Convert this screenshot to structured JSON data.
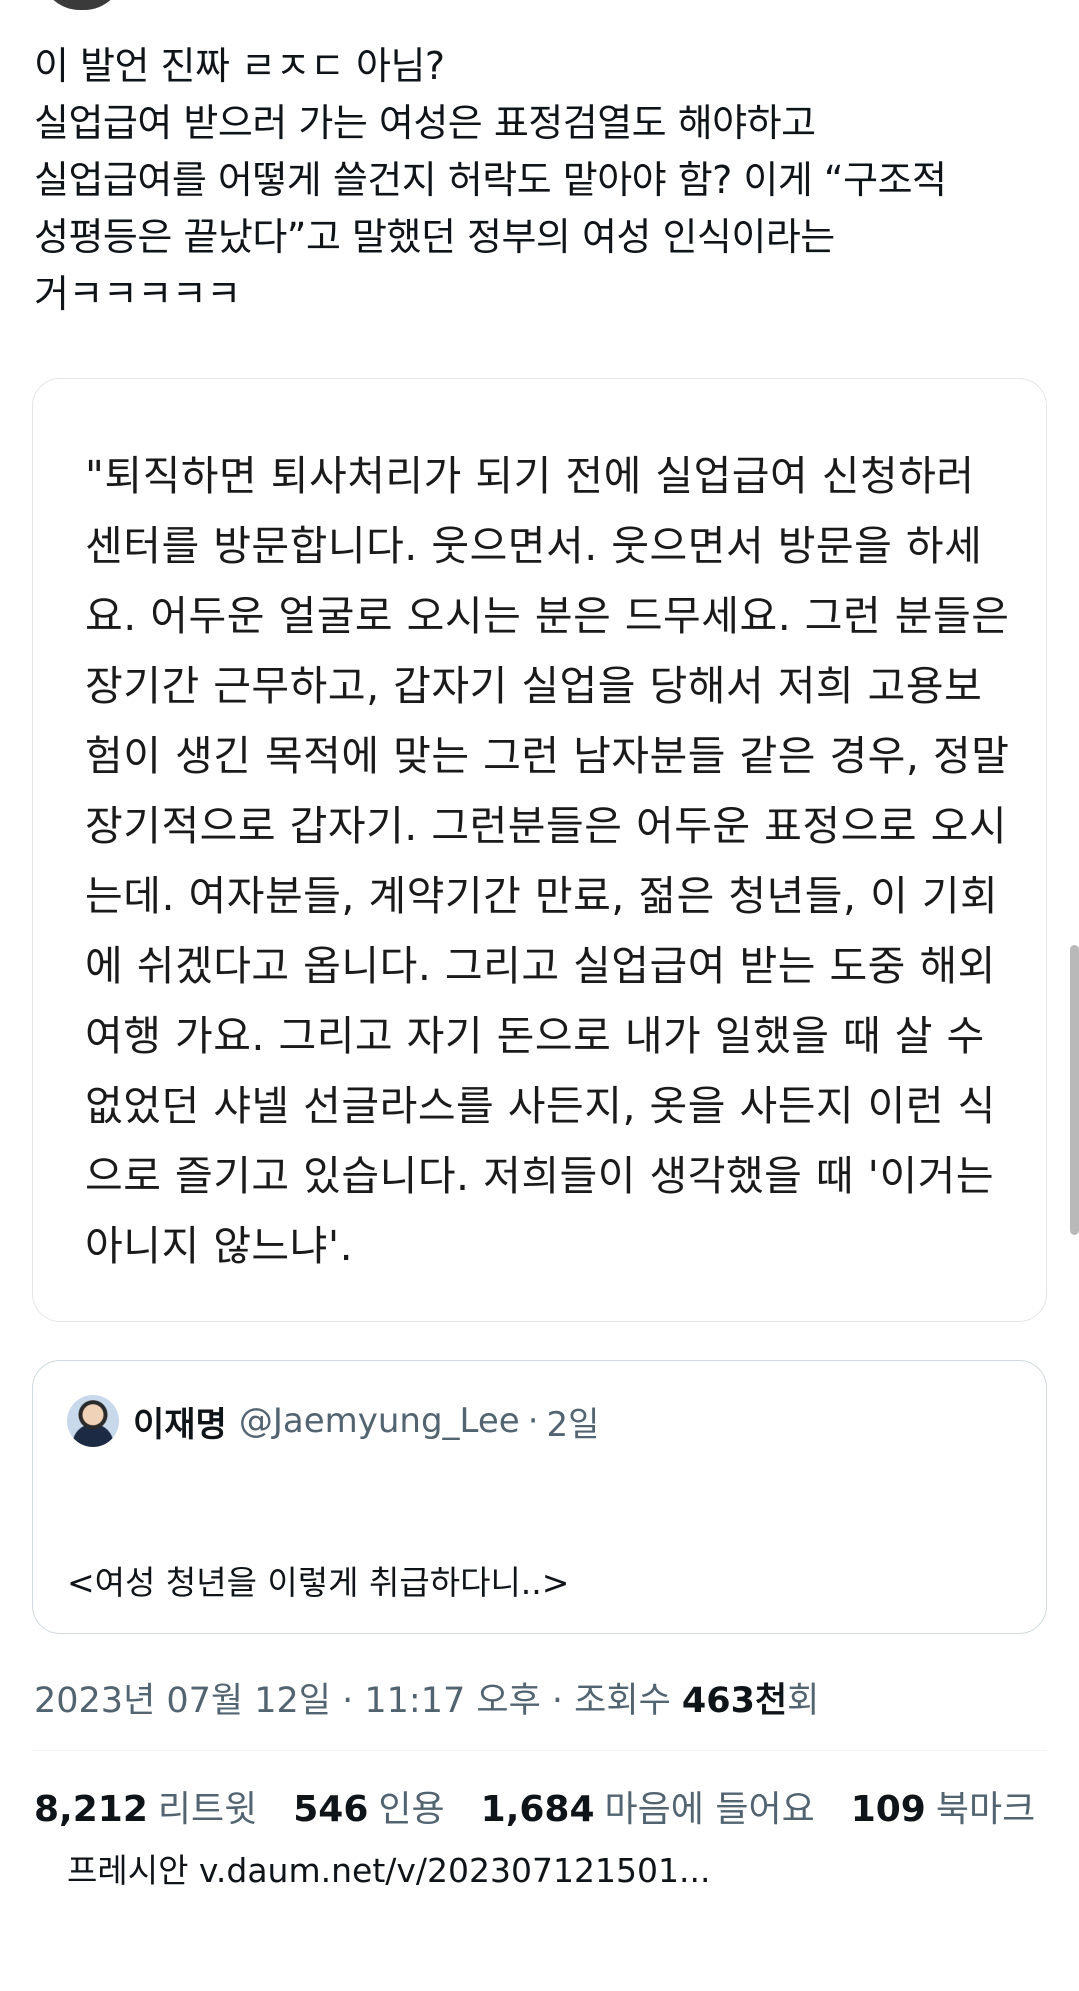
{
  "tweet": {
    "text": "이 발언 진짜 ㄹㅈㄷ 아님?\n실업급여 받으러 가는 여성은 표정검열도 해야하고\n실업급여를 어떻게 쓸건지 허락도 맡아야 함? 이게 “구조적\n성평등은 끝났다”고 말했던 정부의 여성 인식이라는\n거ㅋㅋㅋㅋㅋ"
  },
  "image_card": {
    "text": "\"퇴직하면 퇴사처리가 되기 전에 실업급여 신청하러\n센터를 방문합니다. 웃으면서. 웃으면서 방문을 하세\n요. 어두운 얼굴로 오시는 분은 드무세요. 그런 분들은\n장기간 근무하고, 갑자기 실업을 당해서 저희 고용보\n험이 생긴 목적에 맞는 그런 남자분들 같은 경우, 정말\n장기적으로 갑자기. 그런분들은 어두운 표정으로 오시\n는데. 여자분들, 계약기간 만료, 젊은 청년들, 이 기회\n에 쉬겠다고 옵니다. 그리고 실업급여 받는 도중 해외\n여행 가요. 그리고 자기 돈으로 내가 일했을 때 살 수\n없었던 샤넬 선글라스를 사든지, 옷을 사든지 이런 식\n으로 즐기고 있습니다. 저희들이 생각했을 때 '이거는\n아니지 않느냐'."
  },
  "quoted_tweet": {
    "name": "이재명",
    "handle": "@Jaemyung_Lee",
    "dot": "·",
    "time": "2일",
    "line1": "<여성 청년을 이렇게 취급하다니..>",
    "line2": "프레시안 v.daum.net/v/202307121501..."
  },
  "meta": {
    "date": "2023년 07월 12일",
    "sep1": " · ",
    "time": "11:17 오후",
    "sep2": " · ",
    "views_label": "조회수 ",
    "views_count": "463천",
    "views_suffix": "회"
  },
  "stats": [
    {
      "count": "8,212",
      "label": "리트윗"
    },
    {
      "count": "546",
      "label": "인용"
    },
    {
      "count": "1,684",
      "label": "마음에 들어요"
    },
    {
      "count": "109",
      "label": "북마크"
    }
  ]
}
